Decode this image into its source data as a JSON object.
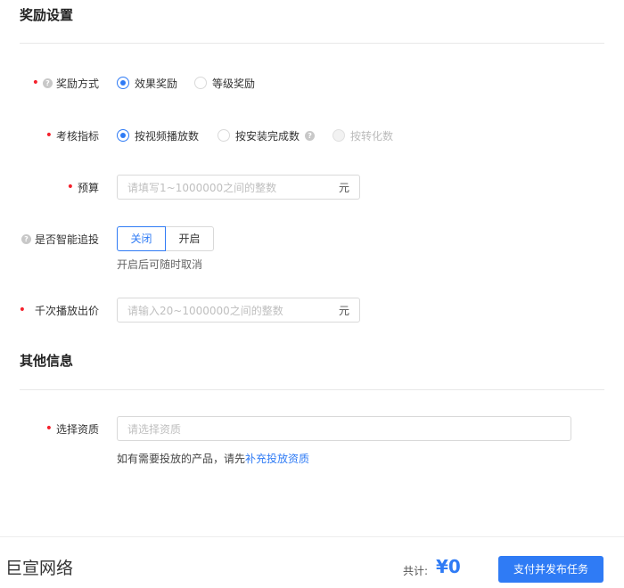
{
  "reward_section": {
    "title": "奖励设置",
    "reward_type": {
      "label": "奖励方式",
      "options": [
        "效果奖励",
        "等级奖励"
      ],
      "selected": "效果奖励"
    },
    "metric": {
      "label": "考核指标",
      "options": [
        "按视频播放数",
        "按安装完成数",
        "按转化数"
      ],
      "selected": "按视频播放数",
      "disabled": "按转化数"
    },
    "budget": {
      "label": "预算",
      "placeholder": "请填写1~1000000之间的整数",
      "suffix": "元"
    },
    "smart": {
      "label": "是否智能追投",
      "options": [
        "关闭",
        "开启"
      ],
      "selected": "关闭",
      "hint": "开启后可随时取消"
    },
    "cpm": {
      "label": "千次播放出价",
      "placeholder": "请输入20~1000000之间的整数",
      "suffix": "元"
    }
  },
  "other_section": {
    "title": "其他信息",
    "qualification": {
      "label": "选择资质",
      "placeholder": "请选择资质",
      "hint_prefix": "如有需要投放的产品，请先",
      "hint_link": "补充投放资质"
    }
  },
  "footer": {
    "brand": "巨宣网络",
    "total_label": "共计:",
    "total_value": "¥0",
    "submit": "支付并发布任务"
  },
  "colors": {
    "accent": "#2f7bf5",
    "required": "#f5222d"
  }
}
